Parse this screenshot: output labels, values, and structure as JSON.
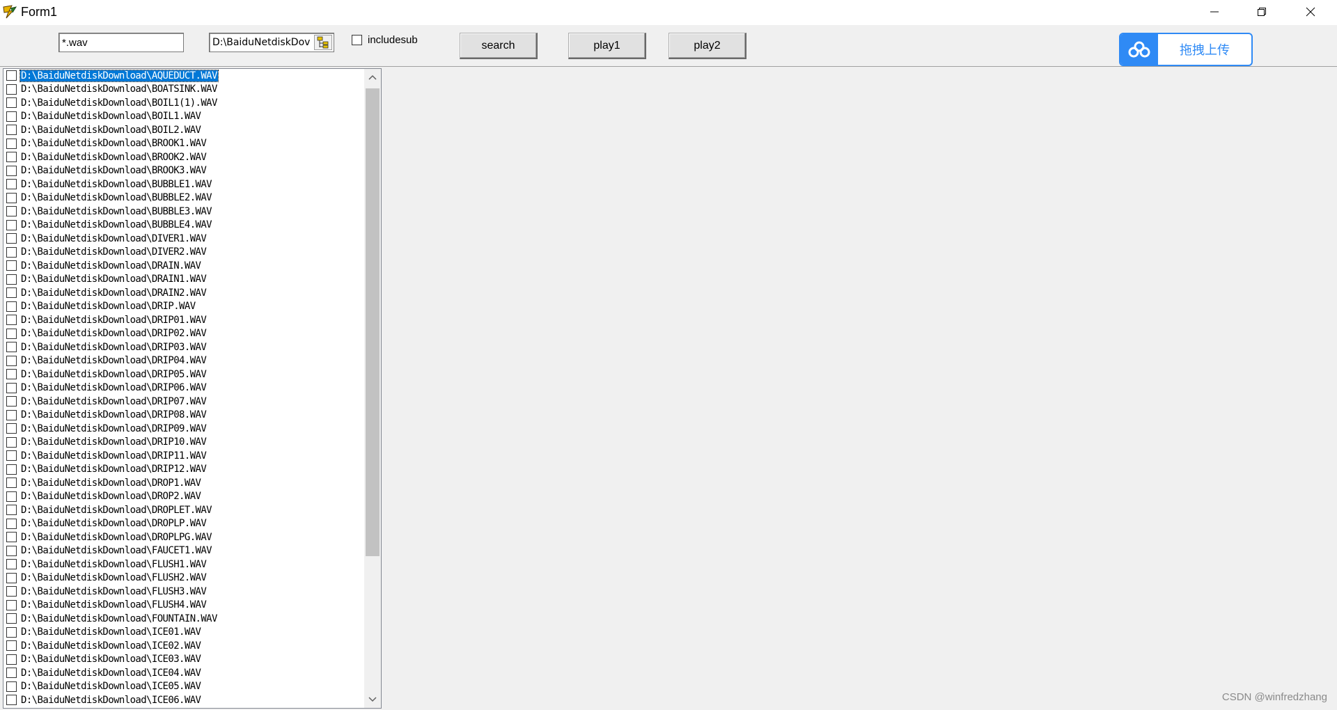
{
  "window": {
    "title": "Form1"
  },
  "toolbar": {
    "mask_value": "*.wav",
    "dir_value": "D:\\BaiduNetdiskDov",
    "include_sub_label": "includesub",
    "search_label": "search",
    "play1_label": "play1",
    "play2_label": "play2"
  },
  "baidu": {
    "label": "拖拽上传",
    "accent": "#2f8af5"
  },
  "files": [
    "D:\\BaiduNetdiskDownload\\AQUEDUCT.WAV",
    "D:\\BaiduNetdiskDownload\\BOATSINK.WAV",
    "D:\\BaiduNetdiskDownload\\BOIL1(1).WAV",
    "D:\\BaiduNetdiskDownload\\BOIL1.WAV",
    "D:\\BaiduNetdiskDownload\\BOIL2.WAV",
    "D:\\BaiduNetdiskDownload\\BROOK1.WAV",
    "D:\\BaiduNetdiskDownload\\BROOK2.WAV",
    "D:\\BaiduNetdiskDownload\\BROOK3.WAV",
    "D:\\BaiduNetdiskDownload\\BUBBLE1.WAV",
    "D:\\BaiduNetdiskDownload\\BUBBLE2.WAV",
    "D:\\BaiduNetdiskDownload\\BUBBLE3.WAV",
    "D:\\BaiduNetdiskDownload\\BUBBLE4.WAV",
    "D:\\BaiduNetdiskDownload\\DIVER1.WAV",
    "D:\\BaiduNetdiskDownload\\DIVER2.WAV",
    "D:\\BaiduNetdiskDownload\\DRAIN.WAV",
    "D:\\BaiduNetdiskDownload\\DRAIN1.WAV",
    "D:\\BaiduNetdiskDownload\\DRAIN2.WAV",
    "D:\\BaiduNetdiskDownload\\DRIP.WAV",
    "D:\\BaiduNetdiskDownload\\DRIP01.WAV",
    "D:\\BaiduNetdiskDownload\\DRIP02.WAV",
    "D:\\BaiduNetdiskDownload\\DRIP03.WAV",
    "D:\\BaiduNetdiskDownload\\DRIP04.WAV",
    "D:\\BaiduNetdiskDownload\\DRIP05.WAV",
    "D:\\BaiduNetdiskDownload\\DRIP06.WAV",
    "D:\\BaiduNetdiskDownload\\DRIP07.WAV",
    "D:\\BaiduNetdiskDownload\\DRIP08.WAV",
    "D:\\BaiduNetdiskDownload\\DRIP09.WAV",
    "D:\\BaiduNetdiskDownload\\DRIP10.WAV",
    "D:\\BaiduNetdiskDownload\\DRIP11.WAV",
    "D:\\BaiduNetdiskDownload\\DRIP12.WAV",
    "D:\\BaiduNetdiskDownload\\DROP1.WAV",
    "D:\\BaiduNetdiskDownload\\DROP2.WAV",
    "D:\\BaiduNetdiskDownload\\DROPLET.WAV",
    "D:\\BaiduNetdiskDownload\\DROPLP.WAV",
    "D:\\BaiduNetdiskDownload\\DROPLPG.WAV",
    "D:\\BaiduNetdiskDownload\\FAUCET1.WAV",
    "D:\\BaiduNetdiskDownload\\FLUSH1.WAV",
    "D:\\BaiduNetdiskDownload\\FLUSH2.WAV",
    "D:\\BaiduNetdiskDownload\\FLUSH3.WAV",
    "D:\\BaiduNetdiskDownload\\FLUSH4.WAV",
    "D:\\BaiduNetdiskDownload\\FOUNTAIN.WAV",
    "D:\\BaiduNetdiskDownload\\ICE01.WAV",
    "D:\\BaiduNetdiskDownload\\ICE02.WAV",
    "D:\\BaiduNetdiskDownload\\ICE03.WAV",
    "D:\\BaiduNetdiskDownload\\ICE04.WAV",
    "D:\\BaiduNetdiskDownload\\ICE05.WAV",
    "D:\\BaiduNetdiskDownload\\ICE06.WAV"
  ],
  "selected_index": 0,
  "watermark": "CSDN @winfredzhang"
}
